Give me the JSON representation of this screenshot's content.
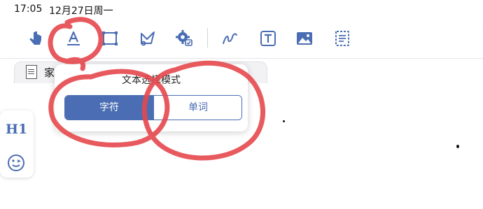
{
  "status_bar": {
    "time": "17:05",
    "date": "12月27日周一"
  },
  "toolbar": {
    "tools": [
      "hand-pointer-icon",
      "text-select-icon",
      "rectangle-select-icon",
      "lasso-icon",
      "settings-icon",
      "pen-icon",
      "text-box-icon",
      "image-icon",
      "dashed-box-icon"
    ],
    "accent": "#4a6db3"
  },
  "tab": {
    "label": "家庭…"
  },
  "popover": {
    "title": "文本选择模式",
    "options": [
      "字符",
      "单词"
    ],
    "selected": "字符"
  },
  "side_panel": {
    "heading_button": "H1",
    "emoji_icon": "emoji-icon"
  },
  "annotation_color": "#e5484d"
}
